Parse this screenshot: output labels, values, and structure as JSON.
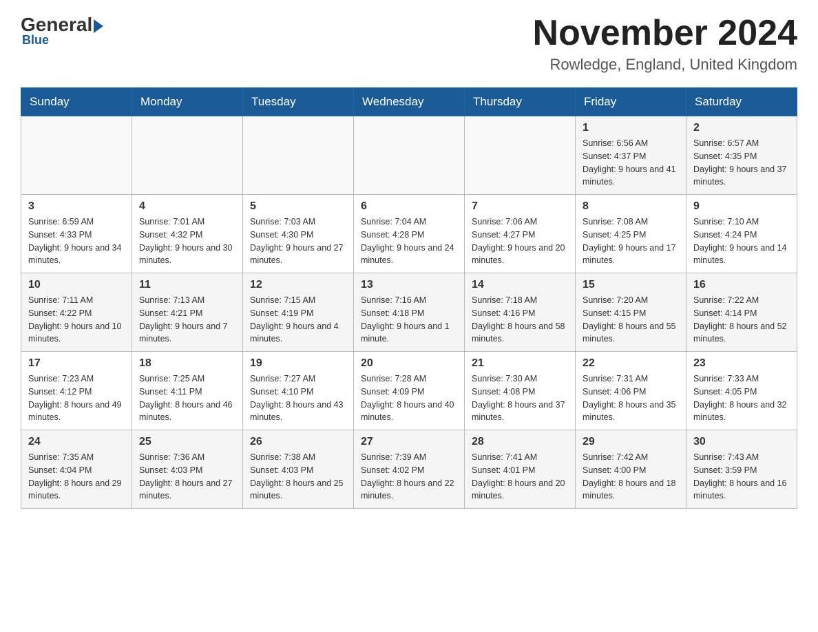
{
  "header": {
    "logo": {
      "general": "General",
      "blue": "Blue"
    },
    "title": "November 2024",
    "location": "Rowledge, England, United Kingdom"
  },
  "days_of_week": [
    "Sunday",
    "Monday",
    "Tuesday",
    "Wednesday",
    "Thursday",
    "Friday",
    "Saturday"
  ],
  "weeks": [
    [
      {
        "day": "",
        "info": ""
      },
      {
        "day": "",
        "info": ""
      },
      {
        "day": "",
        "info": ""
      },
      {
        "day": "",
        "info": ""
      },
      {
        "day": "",
        "info": ""
      },
      {
        "day": "1",
        "info": "Sunrise: 6:56 AM\nSunset: 4:37 PM\nDaylight: 9 hours and 41 minutes."
      },
      {
        "day": "2",
        "info": "Sunrise: 6:57 AM\nSunset: 4:35 PM\nDaylight: 9 hours and 37 minutes."
      }
    ],
    [
      {
        "day": "3",
        "info": "Sunrise: 6:59 AM\nSunset: 4:33 PM\nDaylight: 9 hours and 34 minutes."
      },
      {
        "day": "4",
        "info": "Sunrise: 7:01 AM\nSunset: 4:32 PM\nDaylight: 9 hours and 30 minutes."
      },
      {
        "day": "5",
        "info": "Sunrise: 7:03 AM\nSunset: 4:30 PM\nDaylight: 9 hours and 27 minutes."
      },
      {
        "day": "6",
        "info": "Sunrise: 7:04 AM\nSunset: 4:28 PM\nDaylight: 9 hours and 24 minutes."
      },
      {
        "day": "7",
        "info": "Sunrise: 7:06 AM\nSunset: 4:27 PM\nDaylight: 9 hours and 20 minutes."
      },
      {
        "day": "8",
        "info": "Sunrise: 7:08 AM\nSunset: 4:25 PM\nDaylight: 9 hours and 17 minutes."
      },
      {
        "day": "9",
        "info": "Sunrise: 7:10 AM\nSunset: 4:24 PM\nDaylight: 9 hours and 14 minutes."
      }
    ],
    [
      {
        "day": "10",
        "info": "Sunrise: 7:11 AM\nSunset: 4:22 PM\nDaylight: 9 hours and 10 minutes."
      },
      {
        "day": "11",
        "info": "Sunrise: 7:13 AM\nSunset: 4:21 PM\nDaylight: 9 hours and 7 minutes."
      },
      {
        "day": "12",
        "info": "Sunrise: 7:15 AM\nSunset: 4:19 PM\nDaylight: 9 hours and 4 minutes."
      },
      {
        "day": "13",
        "info": "Sunrise: 7:16 AM\nSunset: 4:18 PM\nDaylight: 9 hours and 1 minute."
      },
      {
        "day": "14",
        "info": "Sunrise: 7:18 AM\nSunset: 4:16 PM\nDaylight: 8 hours and 58 minutes."
      },
      {
        "day": "15",
        "info": "Sunrise: 7:20 AM\nSunset: 4:15 PM\nDaylight: 8 hours and 55 minutes."
      },
      {
        "day": "16",
        "info": "Sunrise: 7:22 AM\nSunset: 4:14 PM\nDaylight: 8 hours and 52 minutes."
      }
    ],
    [
      {
        "day": "17",
        "info": "Sunrise: 7:23 AM\nSunset: 4:12 PM\nDaylight: 8 hours and 49 minutes."
      },
      {
        "day": "18",
        "info": "Sunrise: 7:25 AM\nSunset: 4:11 PM\nDaylight: 8 hours and 46 minutes."
      },
      {
        "day": "19",
        "info": "Sunrise: 7:27 AM\nSunset: 4:10 PM\nDaylight: 8 hours and 43 minutes."
      },
      {
        "day": "20",
        "info": "Sunrise: 7:28 AM\nSunset: 4:09 PM\nDaylight: 8 hours and 40 minutes."
      },
      {
        "day": "21",
        "info": "Sunrise: 7:30 AM\nSunset: 4:08 PM\nDaylight: 8 hours and 37 minutes."
      },
      {
        "day": "22",
        "info": "Sunrise: 7:31 AM\nSunset: 4:06 PM\nDaylight: 8 hours and 35 minutes."
      },
      {
        "day": "23",
        "info": "Sunrise: 7:33 AM\nSunset: 4:05 PM\nDaylight: 8 hours and 32 minutes."
      }
    ],
    [
      {
        "day": "24",
        "info": "Sunrise: 7:35 AM\nSunset: 4:04 PM\nDaylight: 8 hours and 29 minutes."
      },
      {
        "day": "25",
        "info": "Sunrise: 7:36 AM\nSunset: 4:03 PM\nDaylight: 8 hours and 27 minutes."
      },
      {
        "day": "26",
        "info": "Sunrise: 7:38 AM\nSunset: 4:03 PM\nDaylight: 8 hours and 25 minutes."
      },
      {
        "day": "27",
        "info": "Sunrise: 7:39 AM\nSunset: 4:02 PM\nDaylight: 8 hours and 22 minutes."
      },
      {
        "day": "28",
        "info": "Sunrise: 7:41 AM\nSunset: 4:01 PM\nDaylight: 8 hours and 20 minutes."
      },
      {
        "day": "29",
        "info": "Sunrise: 7:42 AM\nSunset: 4:00 PM\nDaylight: 8 hours and 18 minutes."
      },
      {
        "day": "30",
        "info": "Sunrise: 7:43 AM\nSunset: 3:59 PM\nDaylight: 8 hours and 16 minutes."
      }
    ]
  ]
}
